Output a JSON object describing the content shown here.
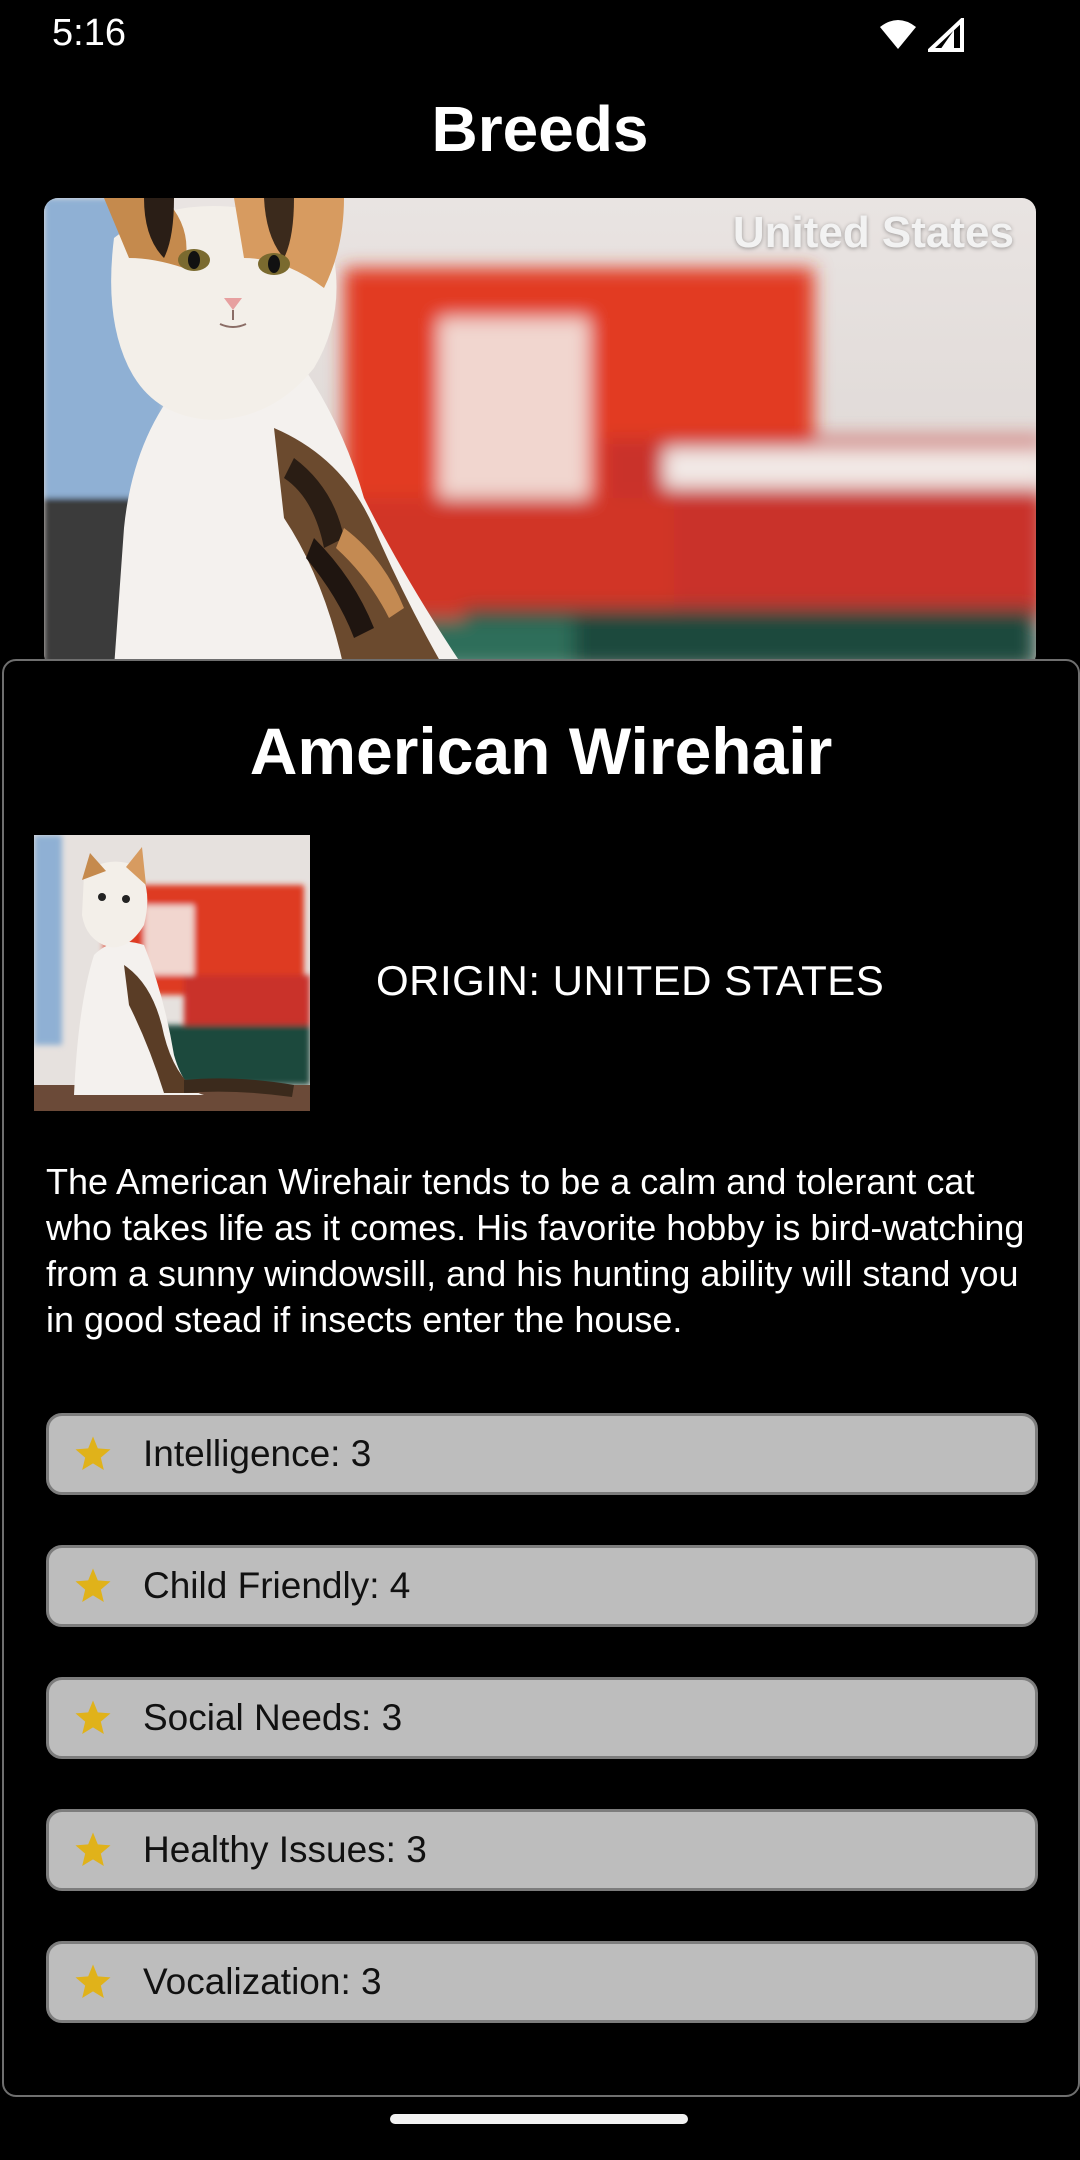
{
  "status_bar": {
    "time": "5:16",
    "wifi_icon": "wifi-icon",
    "signal_icon": "cell-signal-icon"
  },
  "header": {
    "title": "Breeds"
  },
  "hero": {
    "origin_label": "United States",
    "image_icon": "cat-photo"
  },
  "breed": {
    "name": "American Wirehair",
    "origin": "ORIGIN: UNITED STATES",
    "description": "The American Wirehair tends to be a calm and tolerant cat who takes life as it comes. His favorite hobby is bird-watching from a sunny windowsill, and his hunting ability will stand you in good stead if insects enter the house."
  },
  "stats": [
    {
      "label": "Intelligence: 3",
      "icon": "star-icon"
    },
    {
      "label": "Child Friendly: 4",
      "icon": "star-icon"
    },
    {
      "label": "Social Needs: 3",
      "icon": "star-icon"
    },
    {
      "label": "Healthy Issues: 3",
      "icon": "star-icon"
    },
    {
      "label": "Vocalization: 3",
      "icon": "star-icon"
    }
  ],
  "colors": {
    "background": "#000000",
    "stat_card": "#bdbdbd",
    "star": "#e0b21a"
  }
}
